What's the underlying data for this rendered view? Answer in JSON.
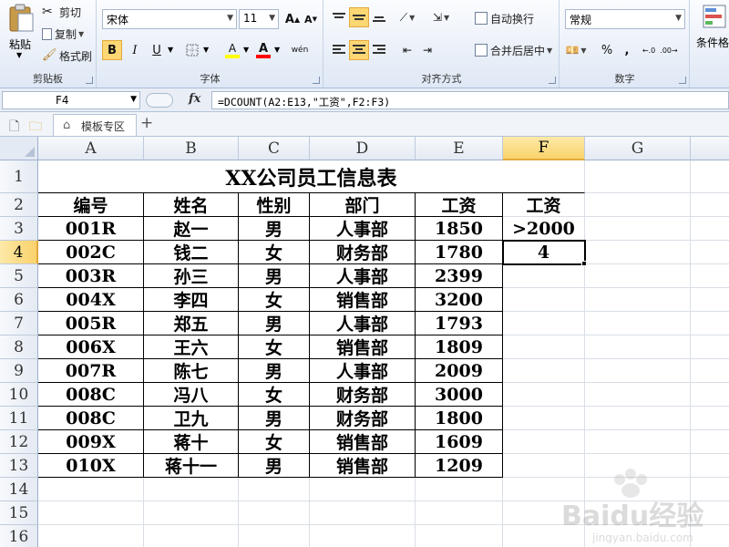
{
  "ribbon": {
    "clipboard": {
      "paste": "粘贴",
      "cut": "剪切",
      "copy": "复制",
      "format_painter": "格式刷",
      "group_label": "剪贴板"
    },
    "font": {
      "name": "宋体",
      "size": "11",
      "bold": "B",
      "italic": "I",
      "underline": "U",
      "fill_glyph": "A",
      "color_glyph": "A",
      "wen_glyph": "wén",
      "group_label": "字体",
      "fill_color": "#ffff00",
      "font_color": "#ff0000"
    },
    "alignment": {
      "wrap_text": "自动换行",
      "merge_center": "合并后居中",
      "group_label": "对齐方式"
    },
    "number": {
      "format": "常规",
      "percent": "%",
      "comma": ",",
      "group_label": "数字"
    },
    "styles": {
      "conditional": "条件格"
    }
  },
  "formula_bar": {
    "name_box": "F4",
    "fx": "fx",
    "formula": "=DCOUNT(A2:E13,\"工资\",F2:F3)"
  },
  "tabs": {
    "items": [
      "模板专区"
    ],
    "add": "+"
  },
  "sheet": {
    "columns": [
      "A",
      "B",
      "C",
      "D",
      "E",
      "F",
      "G"
    ],
    "rows": [
      "1",
      "2",
      "3",
      "4",
      "5",
      "6",
      "7",
      "8",
      "9",
      "10",
      "11",
      "12",
      "13",
      "14",
      "15",
      "16"
    ],
    "selected_cell": "F4",
    "title": "XX公司员工信息表",
    "headers": [
      "编号",
      "姓名",
      "性别",
      "部门",
      "工资"
    ],
    "records": [
      [
        "001R",
        "赵一",
        "男",
        "人事部",
        "1850"
      ],
      [
        "002C",
        "钱二",
        "女",
        "财务部",
        "1780"
      ],
      [
        "003R",
        "孙三",
        "男",
        "人事部",
        "2399"
      ],
      [
        "004X",
        "李四",
        "女",
        "销售部",
        "3200"
      ],
      [
        "005R",
        "郑五",
        "男",
        "人事部",
        "1793"
      ],
      [
        "006X",
        "王六",
        "女",
        "销售部",
        "1809"
      ],
      [
        "007R",
        "陈七",
        "男",
        "人事部",
        "2009"
      ],
      [
        "008C",
        "冯八",
        "女",
        "财务部",
        "3000"
      ],
      [
        "008C",
        "卫九",
        "男",
        "财务部",
        "1800"
      ],
      [
        "009X",
        "蒋十",
        "女",
        "销售部",
        "1609"
      ],
      [
        "010X",
        "蒋十一",
        "男",
        "销售部",
        "1209"
      ]
    ],
    "criteria": {
      "header": "工资",
      "condition": ">2000",
      "result": "4"
    }
  },
  "watermark": {
    "text": "Baidu经验",
    "url": "jingyan.baidu.com"
  }
}
